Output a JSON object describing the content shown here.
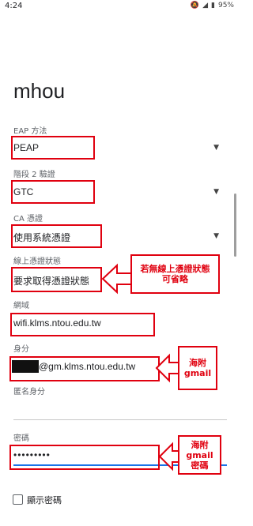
{
  "status": {
    "time": "4:24",
    "battery": "95%"
  },
  "title": "mhou",
  "fields": {
    "eap_label": "EAP 方法",
    "eap_value": "PEAP",
    "phase2_label": "階段 2 驗證",
    "phase2_value": "GTC",
    "ca_label": "CA 憑證",
    "ca_value": "使用系統憑證",
    "online_label": "線上憑證狀態",
    "online_value": "要求取得憑證狀態",
    "domain_label": "網域",
    "domain_value": "wifi.klms.ntou.edu.tw",
    "identity_label": "身分",
    "identity_value": "@gm.klms.ntou.edu.tw",
    "anon_label": "匿名身分",
    "anon_value": "",
    "password_label": "密碼",
    "password_value": "•••••••••",
    "show_password": "顯示密碼"
  },
  "callouts": {
    "online": "若無線上憑證狀態\n可省略",
    "identity": "海附\ngmail",
    "password": "海附 gmail\n密碼"
  },
  "colors": {
    "annotation": "#e0000f",
    "accent": "#1a73e8"
  }
}
